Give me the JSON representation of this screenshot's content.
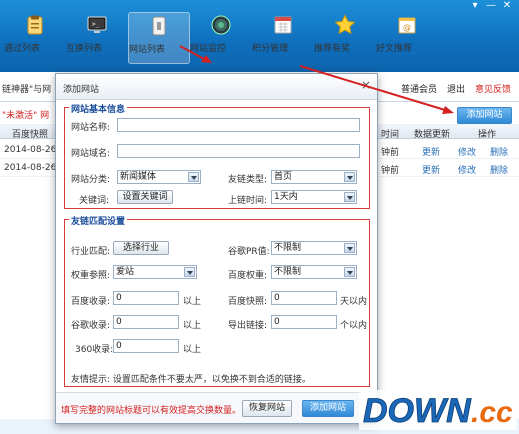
{
  "toolbar": {
    "items": [
      {
        "label": "通过列表",
        "icon": "clipboard-icon"
      },
      {
        "label": "互换列表",
        "icon": "monitor-icon"
      },
      {
        "label": "网站列表",
        "icon": "window-icon"
      },
      {
        "label": "网站监控",
        "icon": "globe-icon"
      },
      {
        "label": "积分管理",
        "icon": "calendar-icon"
      },
      {
        "label": "推荐有奖",
        "icon": "star-icon"
      },
      {
        "label": "好文推荐",
        "icon": "mail-icon"
      }
    ],
    "active_index": 2,
    "window_controls": [
      "▾",
      "—",
      "✕"
    ]
  },
  "subbar": {
    "left_text": "链神器\"与网",
    "user_level": "普通会员",
    "logout": "退出",
    "feedback": "意见反馈"
  },
  "hint_row": {
    "alert": "\"未激活\" 网",
    "add_site_button": "添加网站"
  },
  "table": {
    "headers": {
      "baidu_snapshot": "百度快照",
      "time": "时间",
      "data_update": "数据更新",
      "actions": "操作"
    },
    "rows": [
      {
        "date": "2014-08-26",
        "time": "钟前",
        "update": "更新",
        "edit": "修改",
        "delete": "删除"
      },
      {
        "date": "2014-08-26",
        "time": "钟前",
        "update": "更新",
        "edit": "修改",
        "delete": "删除"
      }
    ]
  },
  "dialog": {
    "title": "添加网站",
    "close": "×",
    "basic": {
      "legend": "网站基本信息",
      "site_name_label": "网站名称:",
      "site_name_value": "",
      "site_domain_label": "网站域名:",
      "site_domain_value": "",
      "category_label": "网站分类:",
      "category_value": "新闻媒体",
      "link_type_label": "友链类型:",
      "link_type_value": "首页",
      "keywords_label": "关键词:",
      "keywords_button": "设置关键词",
      "online_time_label": "上链时间:",
      "online_time_value": "1天内"
    },
    "match": {
      "legend": "友链匹配设置",
      "industry_label": "行业匹配:",
      "industry_button": "选择行业",
      "google_pr_label": "谷歌PR值:",
      "google_pr_value": "不限制",
      "weight_ref_label": "权重参照:",
      "weight_ref_value": "爱站",
      "baidu_weight_label": "百度权重:",
      "baidu_weight_value": "不限制",
      "baidu_index_label": "百度收录:",
      "baidu_index_value": "0",
      "baidu_index_unit": "以上",
      "baidu_snapshot_label": "百度快照:",
      "baidu_snapshot_value": "0",
      "baidu_snapshot_unit": "天以内",
      "google_index_label": "谷歌收录:",
      "google_index_value": "0",
      "google_index_unit": "以上",
      "outlinks_label": "导出链接:",
      "outlinks_value": "0",
      "outlinks_unit": "个以内",
      "s360_label": "360收录:",
      "s360_value": "0",
      "s360_unit": "以上",
      "tip": "友情提示: 设置匹配条件不要太严，以免换不到合适的链接。"
    },
    "footer": {
      "warning": "填写完整的网站标题可以有效提高交换数量。",
      "restore_button": "恢复网站",
      "add_button": "添加网站"
    }
  },
  "watermark": {
    "text": "DOWN.cc"
  },
  "colors": {
    "toolbar": "#0f6fbd",
    "accent_red": "#d63a3a",
    "link_blue": "#2a6fb6",
    "button_blue": "#2f89d6"
  }
}
